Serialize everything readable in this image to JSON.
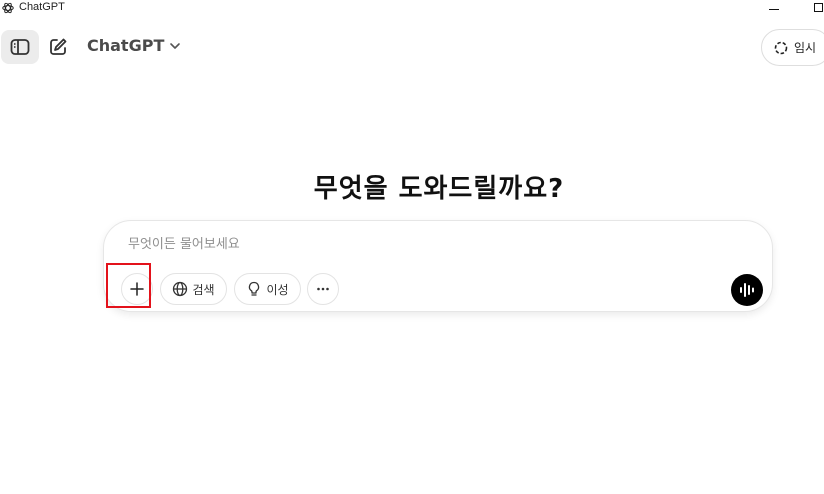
{
  "window": {
    "title": "ChatGPT"
  },
  "header": {
    "model_label": "ChatGPT",
    "temporary_label": "임시"
  },
  "main": {
    "headline": "무엇을 도와드릴까요?"
  },
  "composer": {
    "placeholder": "무엇이든 물어보세요",
    "value": "",
    "search_label": "검색",
    "reason_label": "이성"
  },
  "icons": {
    "logo": "openai-logo-icon",
    "sidebar": "sidebar-toggle-icon",
    "new_chat": "edit-icon",
    "model_dropdown": "chevron-down-icon",
    "temporary": "dashed-circle-icon",
    "attach": "plus-icon",
    "search": "globe-icon",
    "reason": "lightbulb-icon",
    "more": "ellipsis-icon",
    "voice": "waveform-icon"
  },
  "colors": {
    "highlight": "#e3121b",
    "voice_button": "#000000",
    "sidebar_button_bg": "#ececec"
  }
}
